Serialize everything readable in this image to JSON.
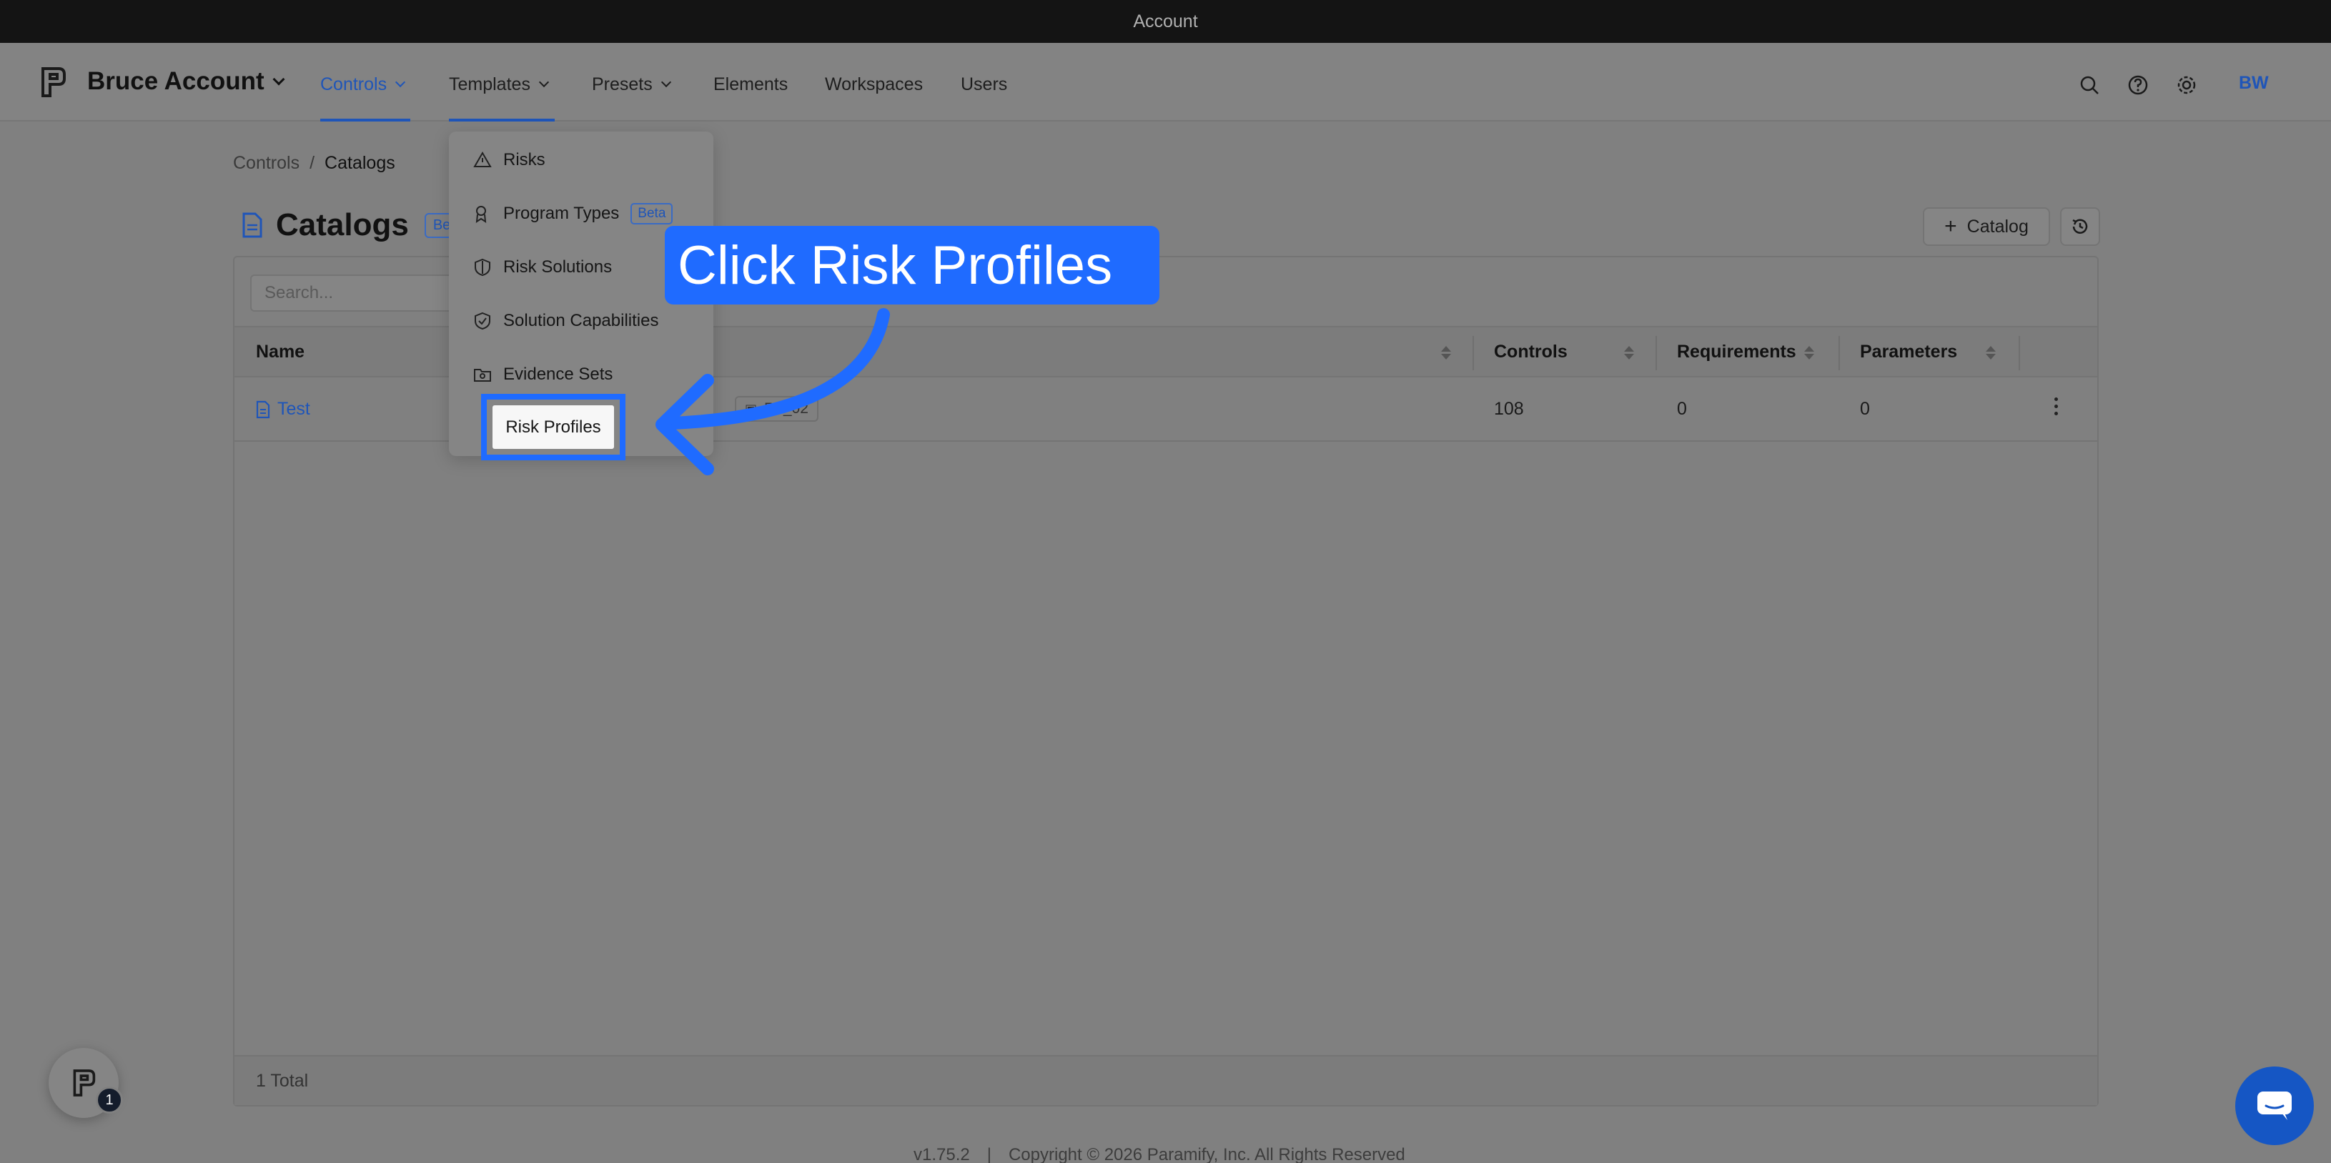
{
  "window": {
    "title": "Account"
  },
  "header": {
    "account_name": "Bruce Account",
    "nav": [
      {
        "label": "Controls"
      },
      {
        "label": "Templates"
      },
      {
        "label": "Presets"
      },
      {
        "label": "Elements"
      },
      {
        "label": "Workspaces"
      },
      {
        "label": "Users"
      }
    ],
    "avatar_initials": "BW",
    "icons": [
      "search-icon",
      "help-icon",
      "gear-icon"
    ]
  },
  "breadcrumb": {
    "parent": "Controls",
    "separator": "/",
    "current": "Catalogs"
  },
  "page": {
    "title": "Catalogs",
    "badge": "Be",
    "add_button": "Catalog"
  },
  "table": {
    "search_placeholder": "Search...",
    "columns": [
      "Name",
      "Controls",
      "Requirements",
      "Parameters"
    ],
    "rows": [
      {
        "name": "Test",
        "tag": "R5_02",
        "controls": "108",
        "requirements": "0",
        "parameters": "0"
      }
    ],
    "total": "1 Total"
  },
  "templates_menu": {
    "items": [
      {
        "label": "Risks",
        "icon": "risk-icon"
      },
      {
        "label": "Program Types",
        "icon": "program-icon",
        "badge": "Beta"
      },
      {
        "label": "Risk Solutions",
        "icon": "shield-icon"
      },
      {
        "label": "Solution Capabilities",
        "icon": "shield-check-icon"
      },
      {
        "label": "Evidence Sets",
        "icon": "folder-icon"
      },
      {
        "label": "Risk Profiles",
        "icon": "profile-icon"
      }
    ]
  },
  "callout": {
    "text": "Click Risk Profiles"
  },
  "footer": {
    "version": "v1.75.2",
    "copyright": "Copyright © 2026 Paramify, Inc. All Rights Reserved"
  },
  "widget": {
    "notification_count": "1"
  },
  "colors": {
    "accent": "#1f55b8",
    "callout": "#1f6bff",
    "overlay": "#808080"
  }
}
